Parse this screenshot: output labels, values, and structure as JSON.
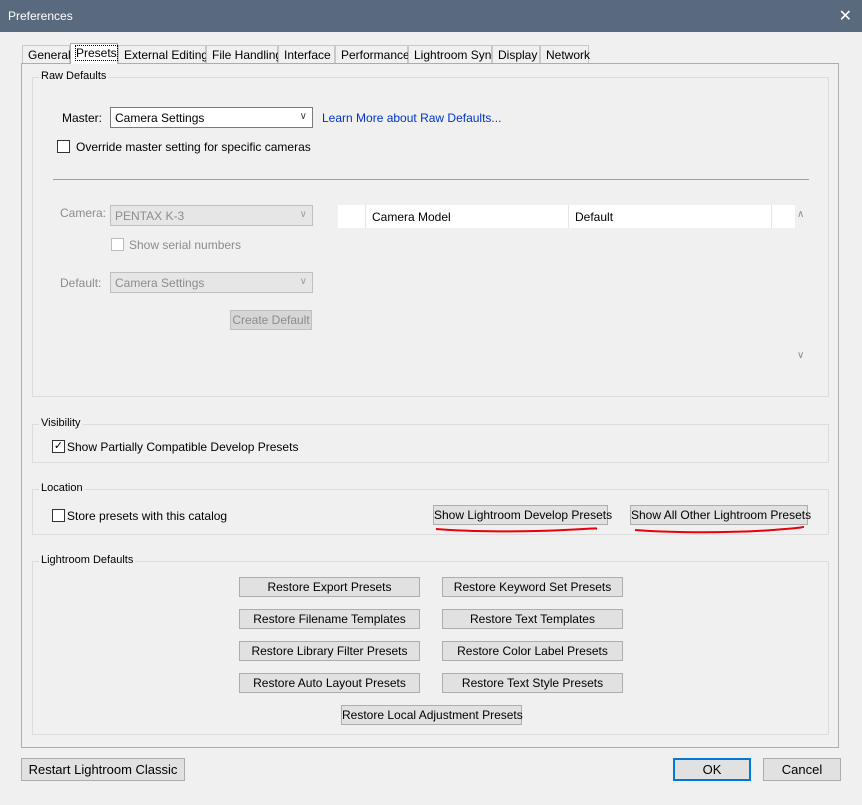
{
  "window": {
    "title": "Preferences"
  },
  "tabs": [
    "General",
    "Presets",
    "External Editing",
    "File Handling",
    "Interface",
    "Performance",
    "Lightroom Sync",
    "Display",
    "Network"
  ],
  "active_tab": "Presets",
  "raw_defaults": {
    "legend": "Raw Defaults",
    "master_label": "Master:",
    "master_value": "Camera Settings",
    "learn_more": "Learn More about Raw Defaults...",
    "override_label": "Override master setting for specific cameras",
    "override_checked": false,
    "camera_label": "Camera:",
    "camera_value": "PENTAX K-3",
    "serial_label": "Show serial numbers",
    "default_label": "Default:",
    "default_value": "Camera Settings",
    "create_default": "Create Default",
    "table": {
      "columns": [
        "Camera Model",
        "Default"
      ]
    }
  },
  "visibility": {
    "legend": "Visibility",
    "partial_label": "Show Partially Compatible Develop Presets",
    "partial_checked": true,
    "check_glyph": "✓"
  },
  "location": {
    "legend": "Location",
    "store_label": "Store presets with this catalog",
    "store_checked": false,
    "show_develop": "Show Lightroom Develop Presets",
    "show_other": "Show All Other Lightroom Presets"
  },
  "defaults": {
    "legend": "Lightroom Defaults",
    "restore_export": "Restore Export Presets",
    "restore_keyword": "Restore Keyword Set Presets",
    "restore_filename": "Restore Filename Templates",
    "restore_text_templates": "Restore Text Templates",
    "restore_library_filter": "Restore Library Filter Presets",
    "restore_color_label": "Restore Color Label Presets",
    "restore_auto_layout": "Restore Auto Layout Presets",
    "restore_text_style": "Restore Text Style Presets",
    "restore_local_adjustment": "Restore Local Adjustment Presets"
  },
  "footer": {
    "restart": "Restart Lightroom Classic",
    "ok": "OK",
    "cancel": "Cancel"
  },
  "icons": {
    "close": "✕",
    "chevron_down": "∨",
    "chevron_up": "∧"
  },
  "colors": {
    "titlebar": "#5a6a7e",
    "link": "#0033cc",
    "annotation": "#e8000b",
    "default_button": "#0078d7"
  }
}
